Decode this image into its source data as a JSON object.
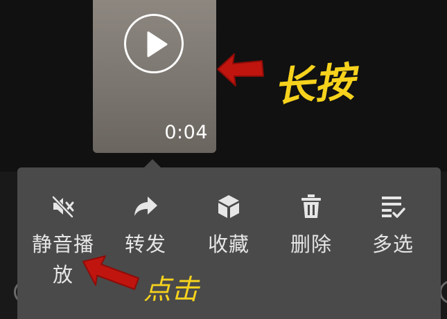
{
  "video": {
    "duration": "0:04"
  },
  "menu": {
    "items": [
      {
        "label": "静音播放",
        "icon": "mute-icon"
      },
      {
        "label": "转发",
        "icon": "forward-icon"
      },
      {
        "label": "收藏",
        "icon": "favorite-cube-icon"
      },
      {
        "label": "删除",
        "icon": "trash-icon"
      },
      {
        "label": "多选",
        "icon": "multi-select-icon"
      }
    ]
  },
  "annotations": {
    "long_press": "长按",
    "tap": "点击",
    "text_color": "#f6d21d",
    "arrow_color": "#c0150f"
  },
  "colors": {
    "background": "#111111",
    "menu_background": "#4a4a4a",
    "menu_text": "#e6e6e6"
  }
}
